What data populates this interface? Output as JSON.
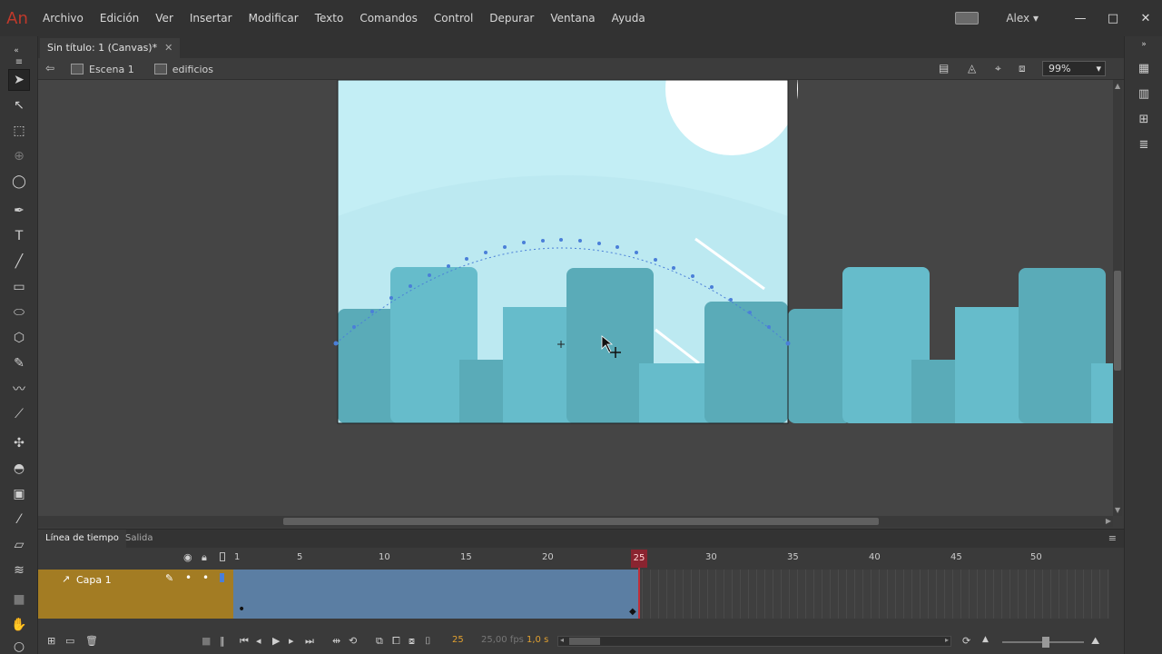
{
  "app": {
    "logo": "An",
    "user": "Alex"
  },
  "menu": [
    "Archivo",
    "Edición",
    "Ver",
    "Insertar",
    "Modificar",
    "Texto",
    "Comandos",
    "Control",
    "Depurar",
    "Ventana",
    "Ayuda"
  ],
  "window_controls": {
    "minimize": "—",
    "maximize": "□",
    "close": "✕"
  },
  "document": {
    "tab_title": "Sin título: 1 (Canvas)*",
    "close_glyph": "✕"
  },
  "editbar": {
    "scene": "Escena 1",
    "symbol": "edificios",
    "zoom": "99%"
  },
  "timeline": {
    "tab_active": "Línea de tiempo",
    "tab_inactive": "Salida",
    "frame_numbers": [
      "1",
      "5",
      "10",
      "15",
      "20",
      "25",
      "30",
      "35",
      "40",
      "45",
      "50"
    ],
    "current_frame": "25",
    "layer_name": "Capa 1",
    "fps": "25,00 fps",
    "time": "1,0 s"
  },
  "colors": {
    "sky": "#c3eef5",
    "sun": "#ffffff",
    "building_light": "#66bccb",
    "building_dark": "#5aabb8",
    "layer_color": "#a37c23",
    "tween_color": "#5b7ea3",
    "playhead": "#c0303a",
    "motion_path": "#4a7fd8"
  }
}
